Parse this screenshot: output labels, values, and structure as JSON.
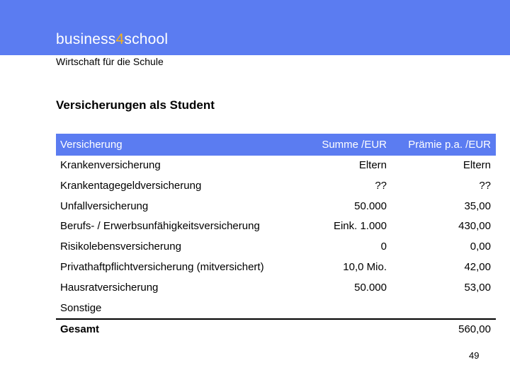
{
  "header": {
    "brand_prefix": "business",
    "brand_accent": "4",
    "brand_suffix": "school",
    "tagline": "Wirtschaft für die Schule",
    "band_color": "#5b7cf1",
    "accent_color": "#f5b21a"
  },
  "title": "Versicherungen als Student",
  "table": {
    "headers": {
      "name": "Versicherung",
      "sum": "Summe /EUR",
      "premium": "Prämie p.a. /EUR"
    },
    "rows": [
      {
        "name": "Krankenversicherung",
        "sum": "Eltern",
        "premium": "Eltern"
      },
      {
        "name": "Krankentagegeldversicherung",
        "sum": "??",
        "premium": "??"
      },
      {
        "name": "Unfallversicherung",
        "sum": "50.000",
        "premium": "35,00"
      },
      {
        "name": "Berufs- / Erwerbsunfähigkeitsversicherung",
        "sum": "Eink. 1.000",
        "premium": "430,00"
      },
      {
        "name": "Risikolebensversicherung",
        "sum": "0",
        "premium": "0,00"
      },
      {
        "name": "Privathaftpflichtversicherung (mitversichert)",
        "sum": "10,0 Mio.",
        "premium": "42,00"
      },
      {
        "name": "Hausratversicherung",
        "sum": "50.000",
        "premium": "53,00"
      },
      {
        "name": "Sonstige",
        "sum": "",
        "premium": ""
      }
    ],
    "total": {
      "name": "Gesamt",
      "sum": "",
      "premium": "560,00"
    }
  },
  "page_number": "49"
}
